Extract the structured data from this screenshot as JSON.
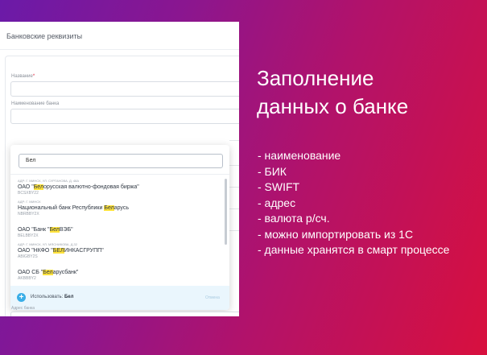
{
  "panel": {
    "title": "Банковские реквизиты",
    "name_label": "Название",
    "required_mark": "*",
    "bank_label": "Наименование банка",
    "address_label": "Адрес банка"
  },
  "dropdown": {
    "search_value": "Бел",
    "items": [
      {
        "address": "АДР: Г. МИНСК, УЛ. СУРГАНОВА, Д. 48А",
        "name_pre": "ОАО \"",
        "name_hl": "Бел",
        "name_post": "орусская валютно-фондовая биржа\"",
        "code": "BCSXBY22"
      },
      {
        "address": "АДР: Г. МИНСК",
        "name_pre": "Национальный банк Республики ",
        "name_hl": "Бел",
        "name_post": "арусь",
        "code": "NBRBBY2X"
      },
      {
        "address": "",
        "name_pre": "ОАО \"Банк \"",
        "name_hl": "Бел",
        "name_post": "ВЭБ\"",
        "code": "BELBBY2X"
      },
      {
        "address": "АДР: Г. МИНСК, УЛ. МЯСНИКОВА, Д.32",
        "name_pre": "ОАО \"НКФО \"",
        "name_hl": "БЕЛ",
        "name_post": "ИНКАСГРУПП\"",
        "code": "ABIGBY2S"
      },
      {
        "address": "",
        "name_pre": "ОАО СБ \"",
        "name_hl": "Бел",
        "name_post": "арусбанк\"",
        "code": "AKBBBY2"
      }
    ],
    "use_label": "Использовать:",
    "use_value": "Бел",
    "other_label": "Отмена"
  },
  "heading": {
    "line1": "Заполнение",
    "line2": "данных о банке"
  },
  "features": [
    "- наименование",
    "- БИК",
    "- SWIFT",
    "- адрес",
    "- валюта р/сч.",
    "- можно импортировать из 1С",
    "- данные хранятся в смарт процессе"
  ],
  "colors": {
    "accent": "#3aaee7",
    "highlight": "#ffe33d",
    "required": "#e0263c"
  },
  "icons": {
    "use": "plus-icon"
  }
}
